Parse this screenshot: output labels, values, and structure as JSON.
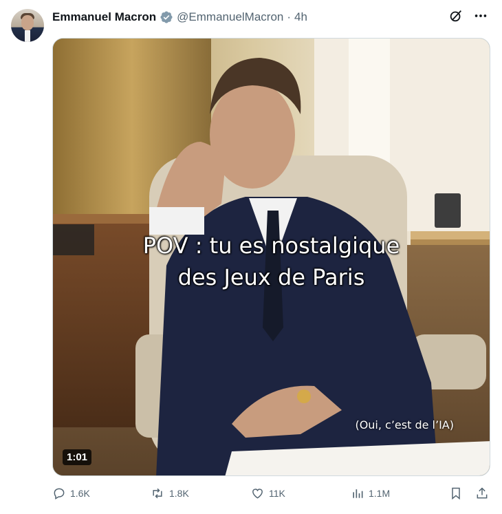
{
  "tweet": {
    "author_name": "Emmanuel Macron",
    "handle": "@EmmanuelMacron",
    "separator": "·",
    "time": "4h"
  },
  "media": {
    "caption_line1": "POV : tu es nostalgique",
    "caption_line2": "des Jeux de Paris",
    "watermark": "(Oui, c’est de l’IA)",
    "duration": "1:01"
  },
  "actions": {
    "replies": "1.6K",
    "reposts": "1.8K",
    "likes": "11K",
    "views": "1.1M"
  },
  "icons": [
    "grok-icon",
    "more-icon",
    "verified-badge-icon",
    "reply-icon",
    "repost-icon",
    "like-icon",
    "views-icon",
    "bookmark-icon",
    "share-icon"
  ],
  "colors": {
    "secondary_text": "#536471",
    "verified": "#829aab"
  }
}
